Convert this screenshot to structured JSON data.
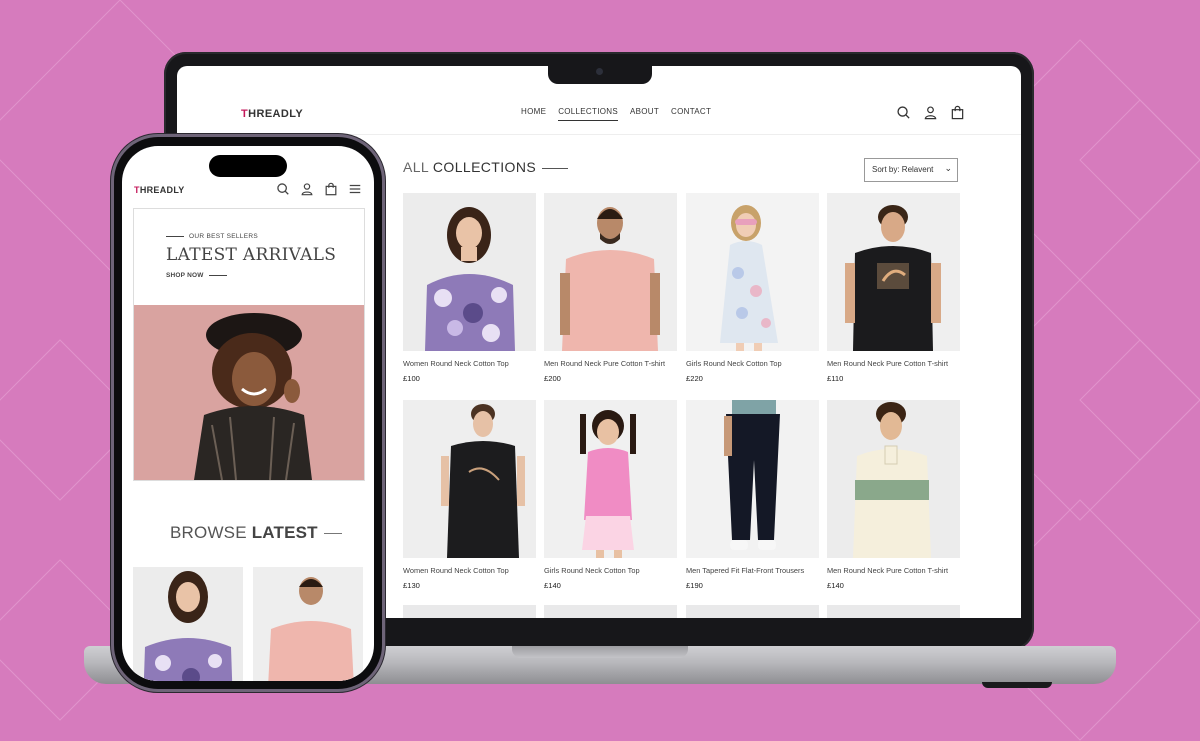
{
  "desktop": {
    "logo": {
      "first_letter": "T",
      "rest": "HREADLY"
    },
    "nav": [
      {
        "label": "HOME",
        "active": false
      },
      {
        "label": "COLLECTIONS",
        "active": true
      },
      {
        "label": "ABOUT",
        "active": false
      },
      {
        "label": "CONTACT",
        "active": false
      }
    ],
    "icons": [
      "search-icon",
      "user-icon",
      "bag-icon"
    ],
    "collection_title_light": "ALL ",
    "collection_title_bold": "COLLECTIONS",
    "sort": {
      "label": "Sort by: Relavent"
    },
    "products": [
      {
        "name": "Women Round Neck Cotton Top",
        "price": "£100"
      },
      {
        "name": "Men Round Neck Pure Cotton T-shirt",
        "price": "£200"
      },
      {
        "name": "Girls Round Neck Cotton Top",
        "price": "£220"
      },
      {
        "name": "Men Round Neck Pure Cotton T-shirt",
        "price": "£110"
      },
      {
        "name": "Women Round Neck Cotton Top",
        "price": "£130"
      },
      {
        "name": "Girls Round Neck Cotton Top",
        "price": "£140"
      },
      {
        "name": "Men Tapered Fit Flat-Front Trousers",
        "price": "£190"
      },
      {
        "name": "Men Round Neck Pure Cotton T-shirt",
        "price": "£140"
      }
    ]
  },
  "mobile": {
    "logo": {
      "first_letter": "T",
      "rest": "HREADLY"
    },
    "icons": [
      "search-icon",
      "user-icon",
      "bag-icon",
      "menu-icon"
    ],
    "hero": {
      "eyebrow": "OUR BEST SELLERS",
      "headline": "LATEST ARRIVALS",
      "cta": "SHOP NOW"
    },
    "browse_light": "BROWSE ",
    "browse_bold": "LATEST"
  },
  "colors": {
    "background": "#d67bbd",
    "brand_accent": "#c4195b"
  }
}
